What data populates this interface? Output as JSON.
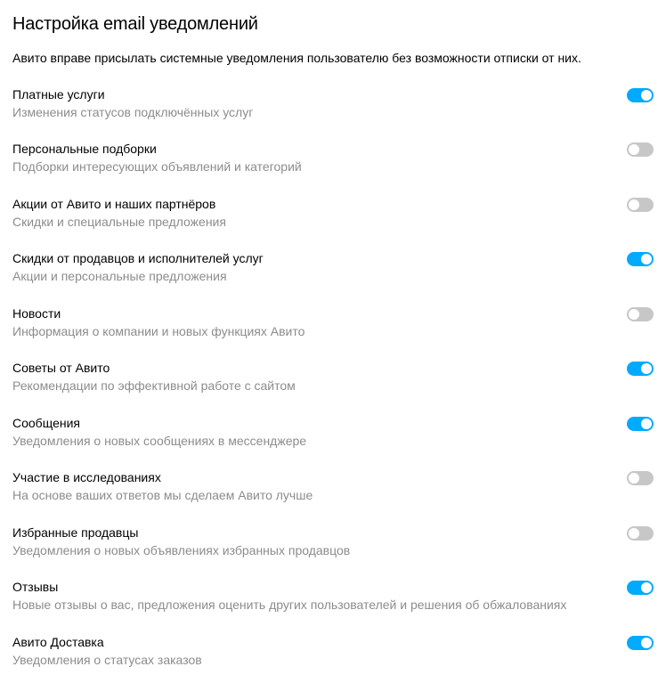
{
  "header": {
    "title": "Настройка email уведомлений",
    "disclaimer": "Авито вправе присылать системные уведомления пользователю без возможности отписки от них."
  },
  "settings": [
    {
      "key": "paid-services",
      "title": "Платные услуги",
      "desc": "Изменения статусов подключённых услуг",
      "enabled": true
    },
    {
      "key": "personal-collections",
      "title": "Персональные подборки",
      "desc": "Подборки интересующих объявлений и категорий",
      "enabled": false
    },
    {
      "key": "promotions",
      "title": "Акции от Авито и наших партнёров",
      "desc": "Скидки и специальные предложения",
      "enabled": false
    },
    {
      "key": "discounts",
      "title": "Скидки от продавцов и исполнителей услуг",
      "desc": "Акции и персональные предложения",
      "enabled": true
    },
    {
      "key": "news",
      "title": "Новости",
      "desc": "Информация о компании и новых функциях Авито",
      "enabled": false
    },
    {
      "key": "tips",
      "title": "Советы от Авито",
      "desc": "Рекомендации по эффективной работе с сайтом",
      "enabled": true
    },
    {
      "key": "messages",
      "title": "Сообщения",
      "desc": "Уведомления о новых сообщениях в мессенджере",
      "enabled": true
    },
    {
      "key": "research",
      "title": "Участие в исследованиях",
      "desc": "На основе ваших ответов мы сделаем Авито лучше",
      "enabled": false
    },
    {
      "key": "fav-sellers",
      "title": "Избранные продавцы",
      "desc": "Уведомления о новых объявлениях избранных продавцов",
      "enabled": false
    },
    {
      "key": "reviews",
      "title": "Отзывы",
      "desc": "Новые отзывы о вас, предложения оценить других пользователей и решения об обжалованиях",
      "enabled": true
    },
    {
      "key": "delivery",
      "title": "Авито Доставка",
      "desc": "Уведомления о статусах заказов",
      "enabled": true
    }
  ]
}
